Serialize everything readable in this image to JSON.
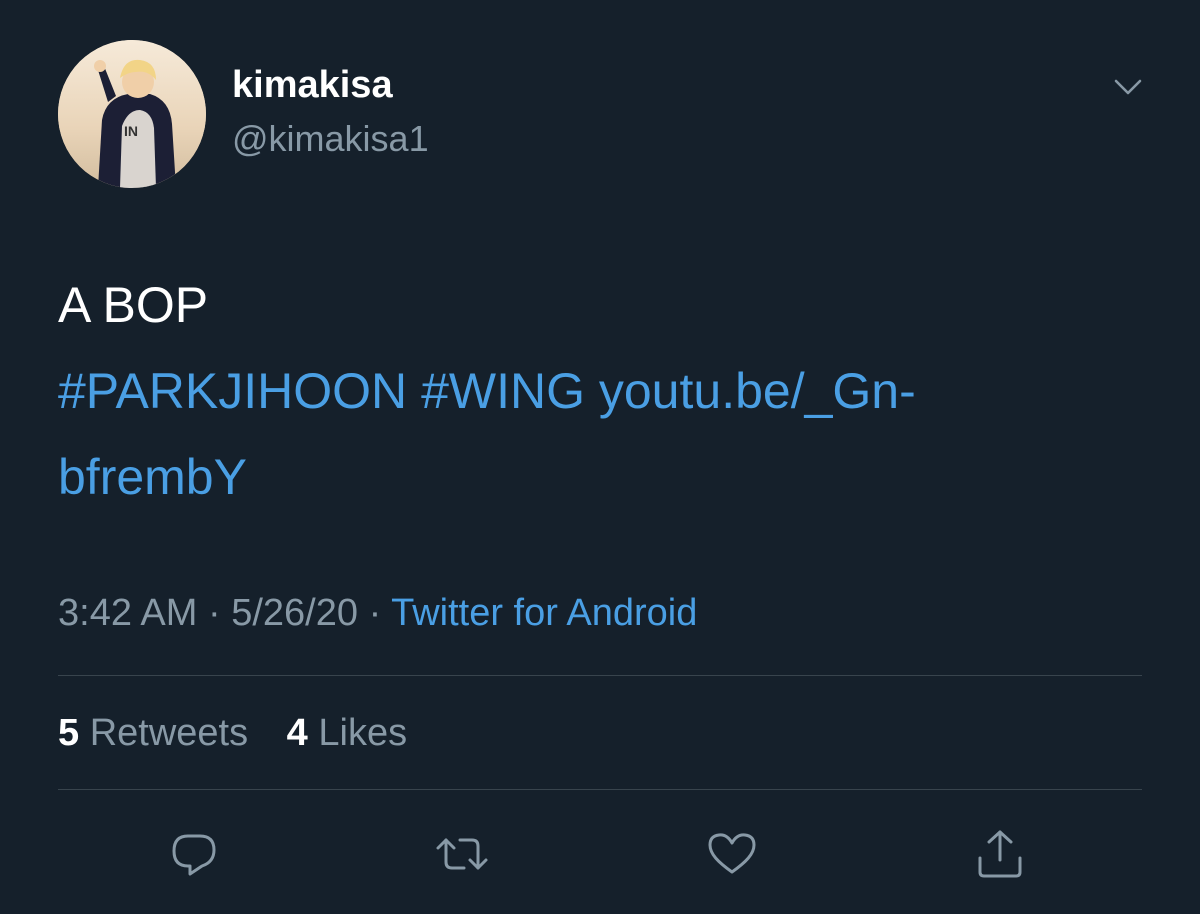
{
  "user": {
    "display_name": "kimakisa",
    "handle": "@kimakisa1",
    "avatar_icon": "profile-photo"
  },
  "tweet": {
    "text": "A BOP",
    "hashtags": [
      "#PARKJIHOON",
      "#WING"
    ],
    "link_text": "youtu.be/_Gn-bfrembY",
    "link_line1": "youtu.be/_Gn-",
    "link_line2": "bfrembY"
  },
  "meta": {
    "time": "3:42 AM",
    "separator": "·",
    "date": "5/26/20",
    "source": "Twitter for Android"
  },
  "stats": {
    "retweets_count": "5",
    "retweets_label": "Retweets",
    "likes_count": "4",
    "likes_label": "Likes"
  },
  "actions": [
    {
      "icon": "reply-icon"
    },
    {
      "icon": "retweet-icon"
    },
    {
      "icon": "like-icon"
    },
    {
      "icon": "share-icon"
    }
  ],
  "colors": {
    "background": "#15202b",
    "primary_text": "#ffffff",
    "secondary_text": "#8899a6",
    "accent": "#4a9fe4",
    "divider": "#38444d"
  }
}
